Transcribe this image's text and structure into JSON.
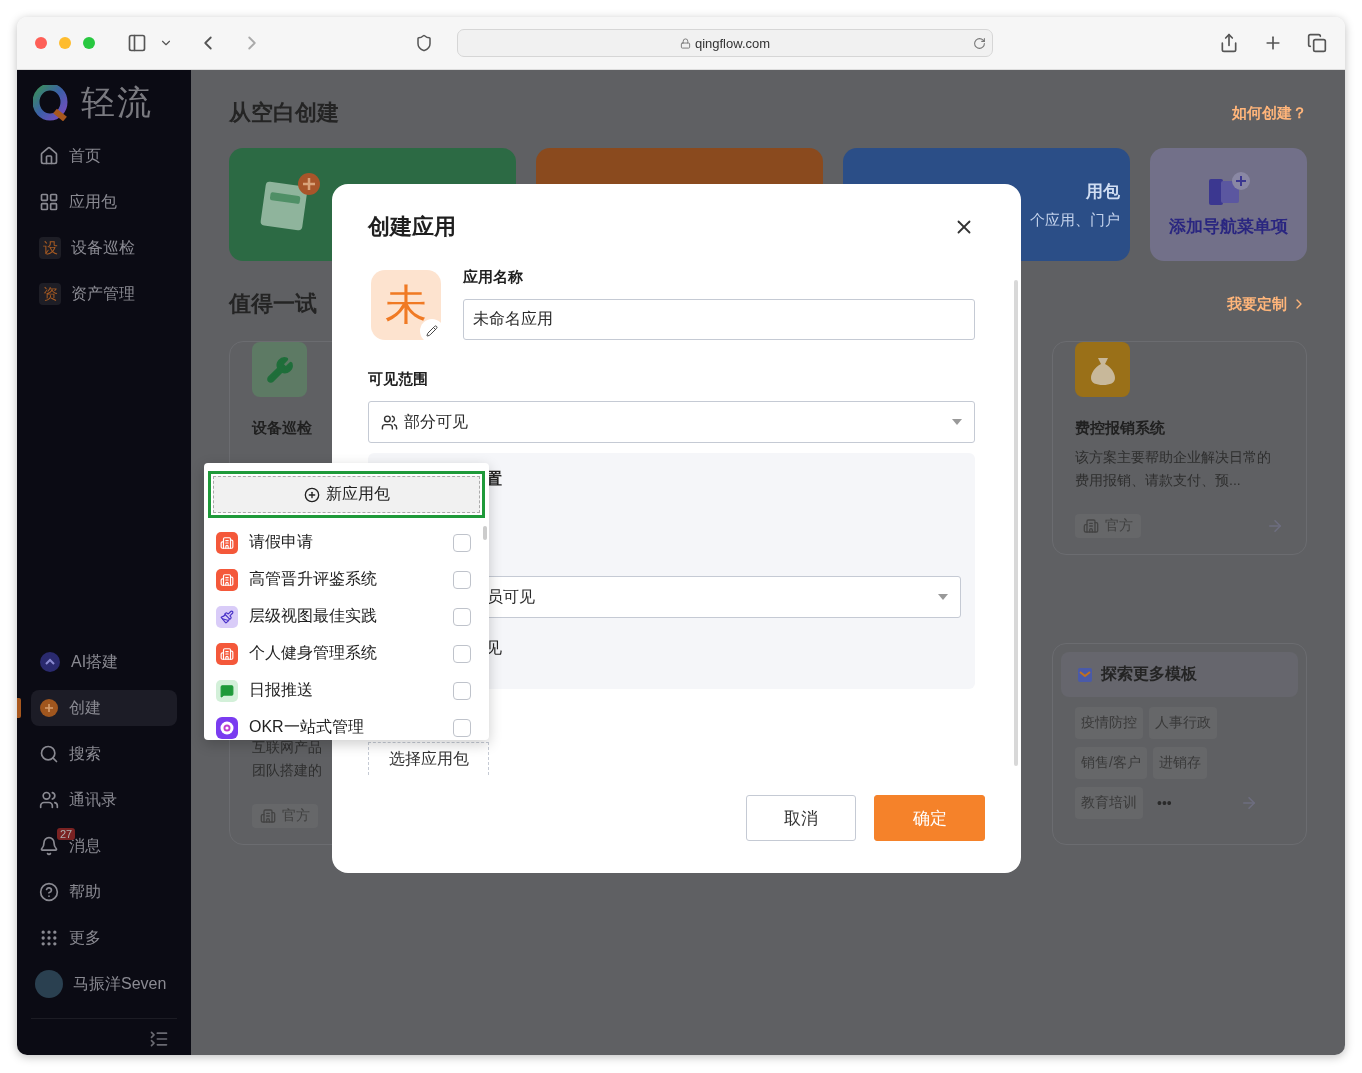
{
  "browser": {
    "url": "qingflow.com"
  },
  "sidebar": {
    "logo": "轻流",
    "top_items": [
      {
        "label": "首页",
        "selected": false
      },
      {
        "label": "应用包",
        "selected": false
      },
      {
        "label": "设备巡检",
        "badge": "设",
        "selected": false
      },
      {
        "label": "资产管理",
        "badge": "资",
        "selected": false
      }
    ],
    "bottom_items": [
      {
        "label": "AI搭建",
        "selected": false
      },
      {
        "label": "创建",
        "selected": true
      },
      {
        "label": "搜索",
        "selected": false
      },
      {
        "label": "通讯录",
        "selected": false
      },
      {
        "label": "消息",
        "count": "27",
        "selected": false
      },
      {
        "label": "帮助",
        "selected": false
      },
      {
        "label": "更多",
        "selected": false
      }
    ],
    "user": {
      "name": "马振洋Seven"
    }
  },
  "main": {
    "blank_title": "从空白创建",
    "help_link": "如何创建？",
    "create_cards": [
      {
        "kind": "app"
      },
      {
        "kind": "portal"
      },
      {
        "kind": "package",
        "title": "用包",
        "subtitle": "个应用、门户"
      },
      {
        "kind": "nav",
        "title": "添加导航菜单项"
      }
    ],
    "try_title": "值得一试",
    "custom_link": "我要定制",
    "featured": [
      {
        "kind": "wrench",
        "title": "设备巡检"
      },
      {
        "kind": "money",
        "title": "费控报销系统",
        "description": "该方案主要帮助企业解决日常的费用报销、请款支付、预...",
        "tag": "官方"
      }
    ],
    "more_card": {
      "lines": [
        "互联网产品",
        "团队搭建的"
      ],
      "tag": "官方"
    },
    "explore": {
      "title": "探索更多模板",
      "tags": [
        "疫情防控",
        "人事行政",
        "销售/客户",
        "进销存",
        "教育培训"
      ],
      "more": "•••"
    }
  },
  "modal": {
    "title": "创建应用",
    "icon_char": "未",
    "name_label": "应用名称",
    "name_value": "未命名应用",
    "visibility_label": "可见范围",
    "visibility_value": "部分可见",
    "panel": {
      "heading": "置",
      "select_value": "员可见",
      "note": "见"
    },
    "package_button": "选择应用包",
    "cancel": "取消",
    "confirm": "确定"
  },
  "dropdown": {
    "new_button": "新应用包",
    "items": [
      {
        "label": "请假申请",
        "kind": "building",
        "checked": false
      },
      {
        "label": "高管晋升评鉴系统",
        "kind": "building",
        "checked": false
      },
      {
        "label": "层级视图最佳实践",
        "kind": "brush",
        "checked": false
      },
      {
        "label": "个人健身管理系统",
        "kind": "building",
        "checked": false
      },
      {
        "label": "日报推送",
        "kind": "message",
        "checked": false
      },
      {
        "label": "OKR一站式管理",
        "kind": "target",
        "checked": false
      }
    ]
  }
}
